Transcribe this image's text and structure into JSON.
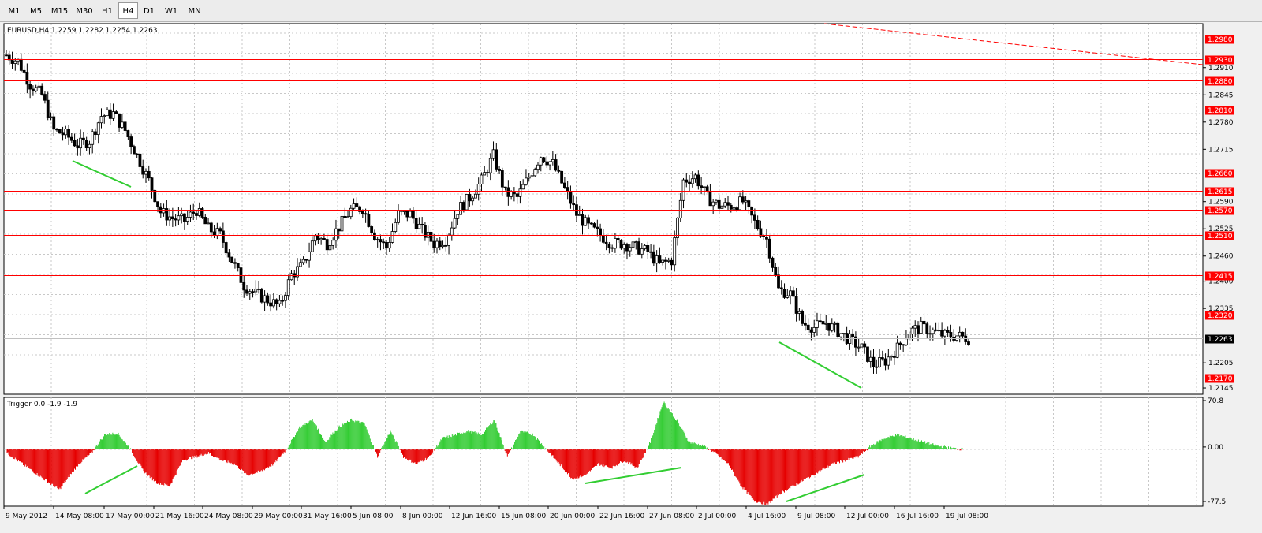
{
  "timeframes": [
    "M1",
    "M5",
    "M15",
    "M30",
    "H1",
    "H4",
    "D1",
    "W1",
    "MN"
  ],
  "active_timeframe": "H4",
  "main_window": {
    "header": "EURUSD,H4  1.2259 1.2282 1.2254 1.2263",
    "price_ticks": [
      "1.2910",
      "1.2845",
      "1.2780",
      "1.2715",
      "1.2590",
      "1.2525",
      "1.2460",
      "1.2400",
      "1.2335",
      "1.2205",
      "1.2145"
    ],
    "levels": [
      "1.2980",
      "1.2930",
      "1.2880",
      "1.2810",
      "1.2660",
      "1.2615",
      "1.2570",
      "1.2510",
      "1.2415",
      "1.2320",
      "1.2170"
    ],
    "current_price": "1.2263",
    "colors": {
      "level_line": "#ff0000",
      "level_label_bg": "#ff0000",
      "current_label_bg": "#000000",
      "trendline": "#ff0000",
      "divergence_line": "#32cd32",
      "candle_bull": "#ffffff",
      "candle_bear": "#000000"
    }
  },
  "indicator_window": {
    "header": "Trigger 0.0 -1.9 -1.9",
    "ticks": [
      "70.8",
      "0.00",
      "-77.5"
    ],
    "colors": {
      "positive_bar": "#33cc33",
      "negative_bar": "#e60000"
    }
  },
  "time_axis": [
    "9 May 2012",
    "14 May 08:00",
    "17 May 00:00",
    "21 May 16:00",
    "24 May 08:00",
    "29 May 00:00",
    "31 May 16:00",
    "5 Jun 08:00",
    "8 Jun 00:00",
    "12 Jun 16:00",
    "15 Jun 08:00",
    "20 Jun 00:00",
    "22 Jun 16:00",
    "27 Jun 08:00",
    "2 Jul 00:00",
    "4 Jul 16:00",
    "9 Jul 08:00",
    "12 Jul 00:00",
    "16 Jul 16:00",
    "19 Jul 08:00"
  ],
  "chart_data": {
    "type": "candlestick",
    "symbol": "EURUSD",
    "timeframe": "H4",
    "price_range": [
      1.213,
      1.3015
    ],
    "ohlc_last": {
      "open": 1.2259,
      "high": 1.2282,
      "low": 1.2254,
      "close": 1.2263
    },
    "close_path": [
      [
        0,
        1.294
      ],
      [
        4,
        1.2925
      ],
      [
        8,
        1.287
      ],
      [
        12,
        1.2845
      ],
      [
        16,
        1.276
      ],
      [
        20,
        1.275
      ],
      [
        24,
        1.2725
      ],
      [
        28,
        1.2735
      ],
      [
        32,
        1.2795
      ],
      [
        36,
        1.28
      ],
      [
        40,
        1.276
      ],
      [
        44,
        1.27
      ],
      [
        48,
        1.264
      ],
      [
        52,
        1.2565
      ],
      [
        56,
        1.255
      ],
      [
        60,
        1.2545
      ],
      [
        64,
        1.257
      ],
      [
        68,
        1.2525
      ],
      [
        72,
        1.251
      ],
      [
        76,
        1.245
      ],
      [
        80,
        1.239
      ],
      [
        84,
        1.237
      ],
      [
        88,
        1.2355
      ],
      [
        92,
        1.234
      ],
      [
        96,
        1.2415
      ],
      [
        100,
        1.244
      ],
      [
        104,
        1.251
      ],
      [
        108,
        1.249
      ],
      [
        112,
        1.253
      ],
      [
        116,
        1.257
      ],
      [
        120,
        1.2575
      ],
      [
        124,
        1.251
      ],
      [
        128,
        1.248
      ],
      [
        132,
        1.256
      ],
      [
        136,
        1.256
      ],
      [
        140,
        1.252
      ],
      [
        144,
        1.249
      ],
      [
        148,
        1.25
      ],
      [
        152,
        1.257
      ],
      [
        156,
        1.26
      ],
      [
        160,
        1.264
      ],
      [
        164,
        1.27
      ],
      [
        168,
        1.261
      ],
      [
        172,
        1.26
      ],
      [
        176,
        1.265
      ],
      [
        180,
        1.27
      ],
      [
        184,
        1.268
      ],
      [
        188,
        1.262
      ],
      [
        192,
        1.256
      ],
      [
        196,
        1.253
      ],
      [
        200,
        1.251
      ],
      [
        204,
        1.249
      ],
      [
        208,
        1.249
      ],
      [
        212,
        1.248
      ],
      [
        216,
        1.247
      ],
      [
        220,
        1.244
      ],
      [
        224,
        1.245
      ],
      [
        228,
        1.264
      ],
      [
        232,
        1.265
      ],
      [
        236,
        1.26
      ],
      [
        240,
        1.258
      ],
      [
        244,
        1.258
      ],
      [
        248,
        1.259
      ],
      [
        252,
        1.254
      ],
      [
        256,
        1.25
      ],
      [
        260,
        1.238
      ],
      [
        264,
        1.237
      ],
      [
        268,
        1.23
      ],
      [
        272,
        1.229
      ],
      [
        276,
        1.23
      ],
      [
        280,
        1.228
      ],
      [
        284,
        1.226
      ],
      [
        288,
        1.224
      ],
      [
        292,
        1.22
      ],
      [
        296,
        1.221
      ],
      [
        300,
        1.224
      ],
      [
        304,
        1.228
      ],
      [
        308,
        1.229
      ],
      [
        312,
        1.228
      ],
      [
        316,
        1.227
      ],
      [
        320,
        1.227
      ],
      [
        324,
        1.2263
      ]
    ],
    "horizontal_levels": [
      1.298,
      1.293,
      1.288,
      1.281,
      1.266,
      1.2615,
      1.257,
      1.251,
      1.2415,
      1.232,
      1.217
    ],
    "indicator": {
      "name": "Trigger",
      "values": [
        0.0,
        -1.9,
        -1.9
      ],
      "range": [
        -77.5,
        70.8
      ],
      "path": [
        [
          0,
          -5
        ],
        [
          8,
          -30
        ],
        [
          16,
          -55
        ],
        [
          22,
          -20
        ],
        [
          26,
          -5
        ],
        [
          30,
          20
        ],
        [
          34,
          22
        ],
        [
          38,
          0
        ],
        [
          42,
          -30
        ],
        [
          46,
          -45
        ],
        [
          50,
          -50
        ],
        [
          54,
          -15
        ],
        [
          58,
          -10
        ],
        [
          62,
          -5
        ],
        [
          66,
          -15
        ],
        [
          70,
          -20
        ],
        [
          74,
          -35
        ],
        [
          78,
          -30
        ],
        [
          82,
          -20
        ],
        [
          86,
          0
        ],
        [
          90,
          30
        ],
        [
          94,
          40
        ],
        [
          98,
          10
        ],
        [
          102,
          30
        ],
        [
          106,
          40
        ],
        [
          110,
          35
        ],
        [
          114,
          -10
        ],
        [
          118,
          25
        ],
        [
          122,
          -10
        ],
        [
          126,
          -20
        ],
        [
          130,
          -10
        ],
        [
          134,
          15
        ],
        [
          138,
          20
        ],
        [
          142,
          25
        ],
        [
          146,
          20
        ],
        [
          150,
          40
        ],
        [
          154,
          -10
        ],
        [
          158,
          25
        ],
        [
          162,
          20
        ],
        [
          166,
          0
        ],
        [
          170,
          -20
        ],
        [
          174,
          -40
        ],
        [
          178,
          -35
        ],
        [
          182,
          -20
        ],
        [
          186,
          -25
        ],
        [
          190,
          -15
        ],
        [
          194,
          -25
        ],
        [
          198,
          10
        ],
        [
          202,
          65
        ],
        [
          206,
          40
        ],
        [
          210,
          10
        ],
        [
          214,
          5
        ],
        [
          218,
          -5
        ],
        [
          222,
          -20
        ],
        [
          226,
          -50
        ],
        [
          230,
          -70
        ],
        [
          234,
          -75
        ],
        [
          238,
          -60
        ],
        [
          242,
          -50
        ],
        [
          246,
          -40
        ],
        [
          250,
          -30
        ],
        [
          254,
          -20
        ],
        [
          258,
          -15
        ],
        [
          262,
          -10
        ],
        [
          266,
          5
        ],
        [
          270,
          15
        ],
        [
          274,
          20
        ],
        [
          278,
          15
        ],
        [
          282,
          10
        ],
        [
          286,
          5
        ],
        [
          290,
          2
        ],
        [
          294,
          0
        ]
      ]
    }
  }
}
